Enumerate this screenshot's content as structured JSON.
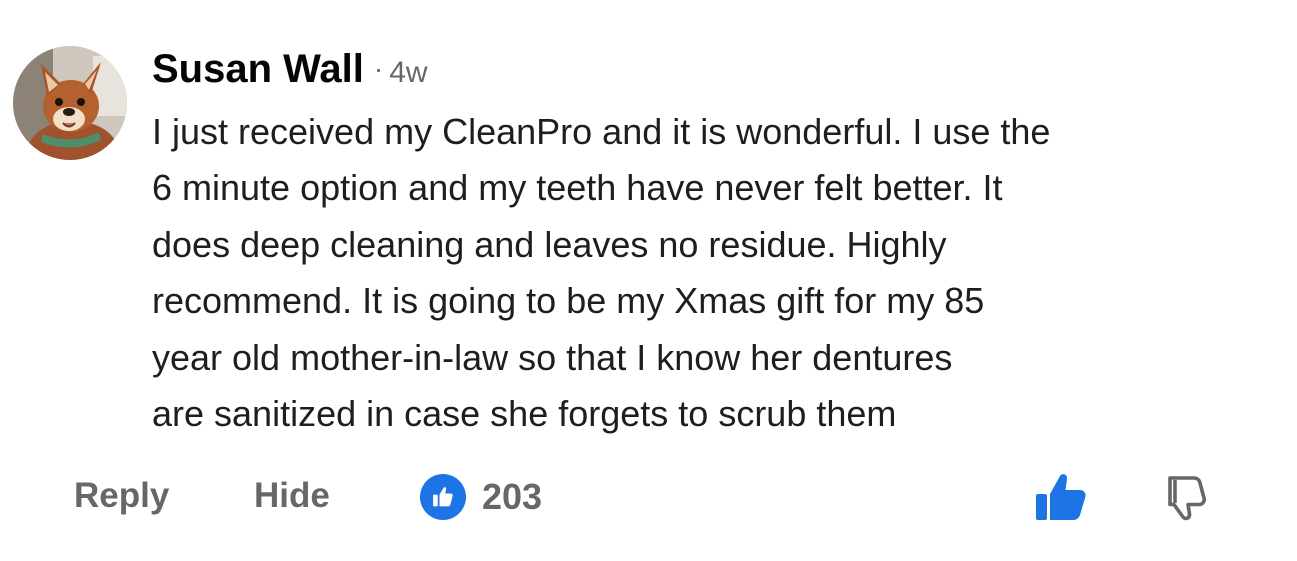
{
  "comment": {
    "author": "Susan Wall",
    "separator": "·",
    "time": "4w",
    "lines": [
      "I just received my CleanPro and it is wonderful. I use the",
      "6 minute option and my teeth have never felt better. It",
      "does deep cleaning and leaves no residue.  Highly",
      "recommend. It is going to be my Xmas gift for my 85",
      "year old mother-in-law so that I know her dentures",
      "are sanitized in case she forgets to scrub them"
    ]
  },
  "actions": {
    "reply_label": "Reply",
    "hide_label": "Hide",
    "like_count": "203"
  },
  "icons": {
    "like_badge": "thumbs-up-icon",
    "like_button": "thumbs-up-icon",
    "dislike_button": "thumbs-down-icon"
  },
  "colors": {
    "accent_blue": "#1d75e5",
    "muted_gray": "#65676b",
    "text": "#1c1e21"
  }
}
